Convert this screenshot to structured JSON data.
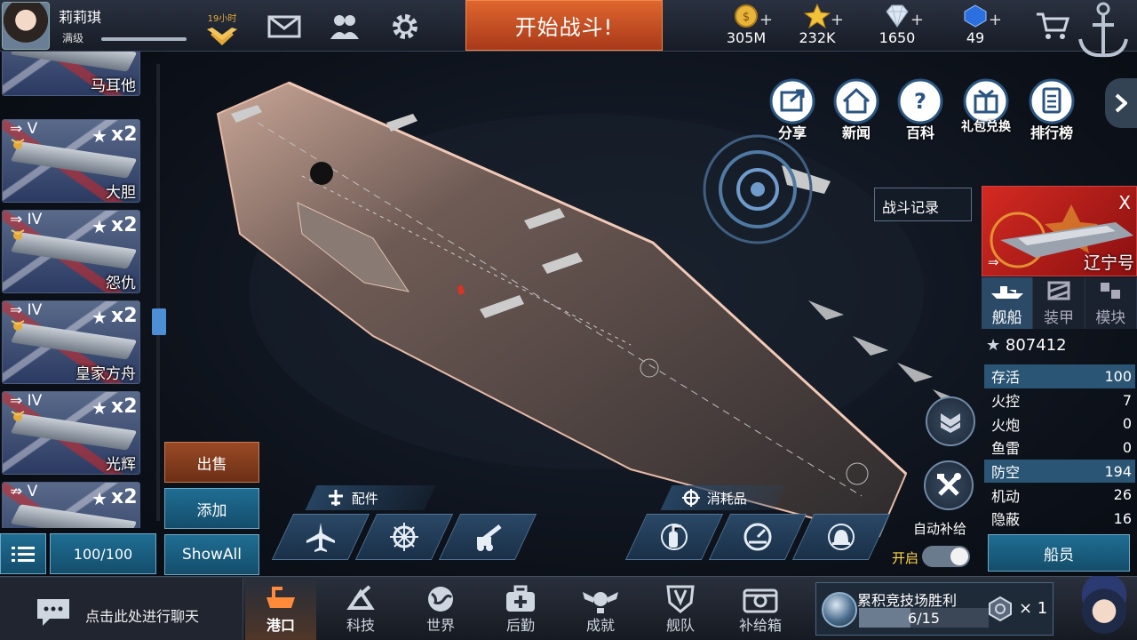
{
  "player": {
    "name": "莉莉琪",
    "level_label": "满级",
    "vip_time": "19小时"
  },
  "battle_button": "开始战斗!",
  "resources": [
    {
      "icon": "gold-coin-icon",
      "value": "305M"
    },
    {
      "icon": "star-icon",
      "value": "232K"
    },
    {
      "icon": "diamond-icon",
      "value": "1650"
    },
    {
      "icon": "blue-gem-icon",
      "value": "49"
    }
  ],
  "ships": [
    {
      "tier": "",
      "name": "马耳他",
      "multiplier": ""
    },
    {
      "tier": "V",
      "name": "大胆",
      "multiplier": "x2"
    },
    {
      "tier": "IV",
      "name": "怨仇",
      "multiplier": "x2"
    },
    {
      "tier": "IV",
      "name": "皇家方舟",
      "multiplier": "x2"
    },
    {
      "tier": "IV",
      "name": "光辉",
      "multiplier": "x2"
    },
    {
      "tier": "V",
      "name": "",
      "multiplier": "x2"
    }
  ],
  "side_buttons": {
    "sell": "出售",
    "add": "添加",
    "show_all": "ShowAll",
    "capacity": "100/100"
  },
  "top_menu": [
    "分享",
    "新闻",
    "百科",
    "礼包兑换",
    "排行榜"
  ],
  "battle_log": "战斗记录",
  "selected_ship": {
    "name": "辽宁号",
    "close": "X",
    "tabs": [
      "舰船",
      "装甲",
      "模块"
    ],
    "power": "807412",
    "stats": [
      {
        "label": "存活",
        "value": "100"
      },
      {
        "label": "火控",
        "value": "7"
      },
      {
        "label": "火炮",
        "value": "0"
      },
      {
        "label": "鱼雷",
        "value": "0"
      },
      {
        "label": "防空",
        "value": "194"
      },
      {
        "label": "机动",
        "value": "26"
      },
      {
        "label": "隐蔽",
        "value": "16"
      }
    ],
    "crew_button": "船员",
    "auto_supply": "自动补给",
    "auto_supply_state": "开启"
  },
  "equip_bar": {
    "parts_label": "配件",
    "consumables_label": "消耗品"
  },
  "chat_placeholder": "点击此处进行聊天",
  "nav": [
    "港口",
    "科技",
    "世界",
    "后勤",
    "成就",
    "舰队",
    "补给箱"
  ],
  "arena": {
    "title": "累积竞技场胜利",
    "progress_text": "6/15",
    "progress": 0.4,
    "count": "× 1"
  },
  "colors": {
    "battle_button": "#c8502a",
    "accent_blue": "#1f6e93",
    "flag_red": "#d42a22"
  }
}
